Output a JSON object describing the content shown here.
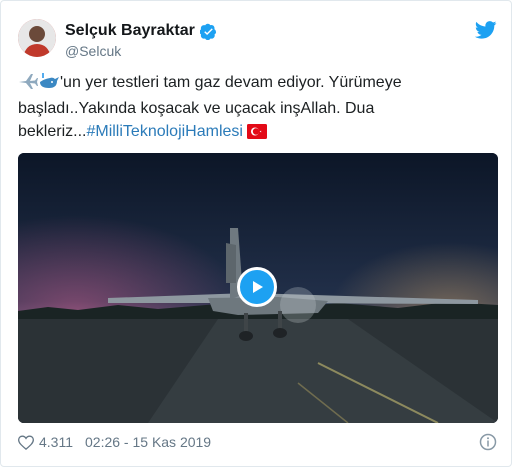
{
  "tweet": {
    "display_name": "Selçuk Bayraktar",
    "handle": "@Selcuk",
    "text_part1": "'un yer testleri tam gaz devam ediyor. Yürümeye başladı..Yakında koşacak ve uçacak inşAllah. Dua bekleriz...",
    "hashtag": "#MilliTeknolojiHamlesi",
    "emojis": [
      "airplane-emoji",
      "whale-emoji",
      "turkey-flag-emoji"
    ]
  },
  "footer": {
    "like_count": "4.311",
    "timestamp": "02:26 - 15 Kas 2019"
  },
  "colors": {
    "twitter_blue": "#1da1f2",
    "hashtag": "#2b7bb9",
    "muted": "#657786"
  }
}
